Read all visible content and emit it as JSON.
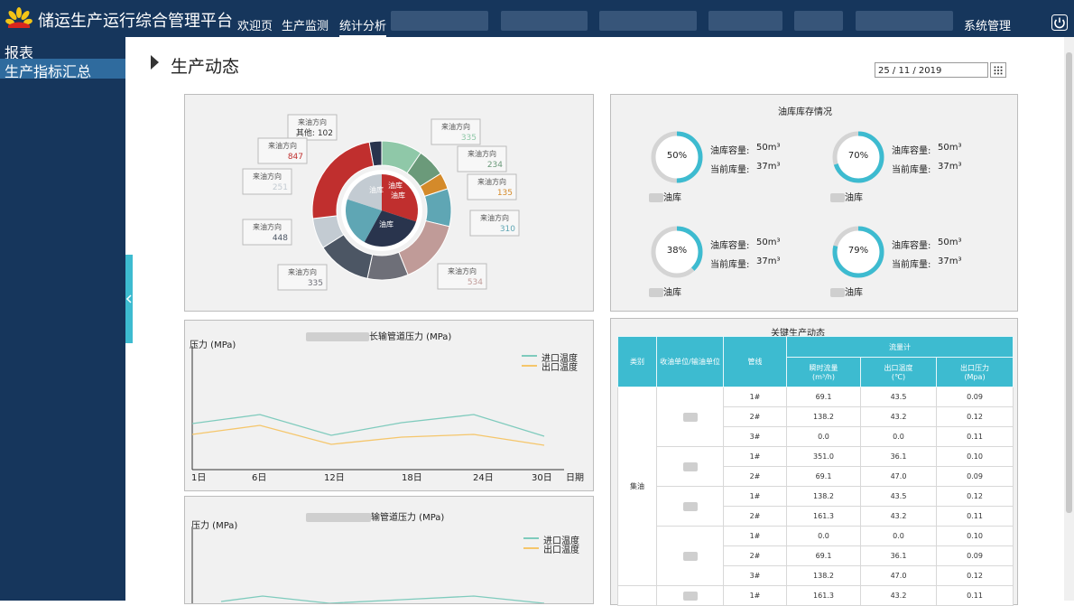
{
  "header": {
    "app_title": "储运生产运行综合管理平台",
    "nav": [
      "欢迎页",
      "生产监测",
      "统计分析"
    ],
    "active_nav": "统计分析",
    "system_menu": "系统管理"
  },
  "sidebar": {
    "section": "报表",
    "items": [
      "生产指标汇总"
    ]
  },
  "page": {
    "title": "生产动态",
    "date": "25 / 11 / 2019"
  },
  "donut": {
    "outer_labels": [
      {
        "dir": "来油方向",
        "value": "102",
        "prefix": "其他:",
        "color": "#29344d"
      },
      {
        "dir": "来油方向",
        "value": "335",
        "color": "#8fc8a8"
      },
      {
        "dir": "来油方向",
        "value": "234",
        "color": "#6b9a7a"
      },
      {
        "dir": "来油方向",
        "value": "135",
        "color": "#d48a2a"
      },
      {
        "dir": "来油方向",
        "value": "310",
        "color": "#5fa6b4"
      },
      {
        "dir": "来油方向",
        "value": "534",
        "color": "#c09b98"
      },
      {
        "dir": "来油方向",
        "value": "335",
        "color": "#6e6f78"
      },
      {
        "dir": "来油方向",
        "value": "448",
        "color": "#4c5664"
      },
      {
        "dir": "来油方向",
        "value": "251",
        "color": "#c3cbd2"
      },
      {
        "dir": "来油方向",
        "value": "847",
        "color": "#c02f2e"
      }
    ],
    "inner_labels": [
      "油库",
      "油库",
      "油库",
      "油库"
    ]
  },
  "inventory": {
    "title": "油库库存情况",
    "capacity_label": "油库容量:",
    "current_label": "当前库量:",
    "tanks": [
      {
        "percent": 50,
        "pct_text": "50%",
        "capacity": "50m³",
        "current": "37m³",
        "name": "油库"
      },
      {
        "percent": 70,
        "pct_text": "70%",
        "capacity": "50m³",
        "current": "37m³",
        "name": "油库"
      },
      {
        "percent": 38,
        "pct_text": "38%",
        "capacity": "50m³",
        "current": "37m³",
        "name": "油库"
      },
      {
        "percent": 79,
        "pct_text": "79%",
        "capacity": "50m³",
        "current": "37m³",
        "name": "油库"
      }
    ]
  },
  "pressure_chart_1": {
    "title": "长输管道压力 (MPa)",
    "ylabel": "压力 (MPa)",
    "xlabel": "日期",
    "x_ticks": [
      "1日",
      "6日",
      "12日",
      "18日",
      "24日",
      "30日"
    ],
    "legend": [
      "进口温度",
      "出口温度"
    ]
  },
  "pressure_chart_2": {
    "title": "输管道压力 (MPa)",
    "ylabel": "压力 (MPa)",
    "legend": [
      "进口温度",
      "出口温度"
    ]
  },
  "kpi_table": {
    "title": "关键生产动态",
    "headers": {
      "category": "类别",
      "unit": "收油单位/输油单位",
      "pipeline": "管线",
      "flowmeter": "流量计",
      "instant_flow": "瞬时流量",
      "instant_flow_unit": "(m³/h)",
      "out_temp": "出口温度",
      "out_temp_unit": "(℃)",
      "out_pressure": "出口压力",
      "out_pressure_unit": "(Mpa)"
    },
    "category_name": "集油",
    "rows": [
      [
        "1#",
        "69.1",
        "43.5",
        "0.09"
      ],
      [
        "2#",
        "138.2",
        "43.2",
        "0.12"
      ],
      [
        "3#",
        "0.0",
        "0.0",
        "0.11"
      ],
      [
        "1#",
        "351.0",
        "36.1",
        "0.10"
      ],
      [
        "2#",
        "69.1",
        "47.0",
        "0.09"
      ],
      [
        "1#",
        "138.2",
        "43.5",
        "0.12"
      ],
      [
        "2#",
        "161.3",
        "43.2",
        "0.11"
      ],
      [
        "1#",
        "0.0",
        "0.0",
        "0.10"
      ],
      [
        "2#",
        "69.1",
        "36.1",
        "0.09"
      ],
      [
        "3#",
        "138.2",
        "47.0",
        "0.12"
      ],
      [
        "1#",
        "161.3",
        "43.2",
        "0.11"
      ]
    ]
  },
  "colors": {
    "header_bg": "#16365c",
    "accent": "#3dbbd0",
    "line_inlet": "#7fcbbd",
    "line_outlet": "#f5c66b"
  }
}
